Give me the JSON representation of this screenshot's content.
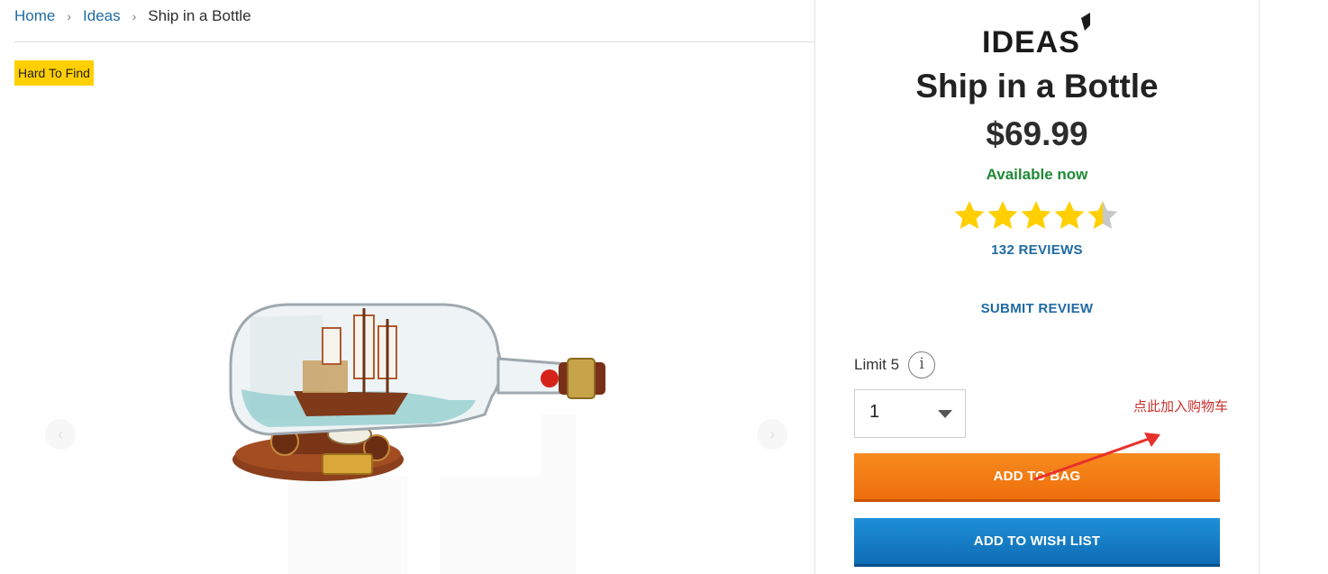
{
  "breadcrumb": {
    "home": "Home",
    "category": "Ideas",
    "current": "Ship in a Bottle"
  },
  "badge": "Hard To Find",
  "gallery": {
    "prev_icon": "chevron-left-icon",
    "next_icon": "chevron-right-icon",
    "prev_glyph": "‹",
    "next_glyph": "›"
  },
  "product": {
    "brand_logo": "IDEAS",
    "title": "Ship in a Bottle",
    "price": "$69.99",
    "availability": "Available now",
    "rating": 4.5,
    "rating_max": 5,
    "reviews_link": "132 REVIEWS",
    "submit_review": "SUBMIT REVIEW",
    "limit_label": "Limit 5",
    "info_glyph": "i",
    "quantity": "1",
    "add_to_bag": "ADD TO BAG",
    "add_to_wish_list": "ADD TO WISH LIST"
  },
  "annotation": {
    "note": "点此加入购物车"
  },
  "colors": {
    "link": "#1f6aa3",
    "badge": "#ffcf00",
    "available": "#1f8a36",
    "star": "#ffcf00",
    "star_empty": "#c8c8c8",
    "add_to_bag": "#ee6e0c",
    "wish_list": "#0f6cb4",
    "annotation": "#e8302c"
  }
}
